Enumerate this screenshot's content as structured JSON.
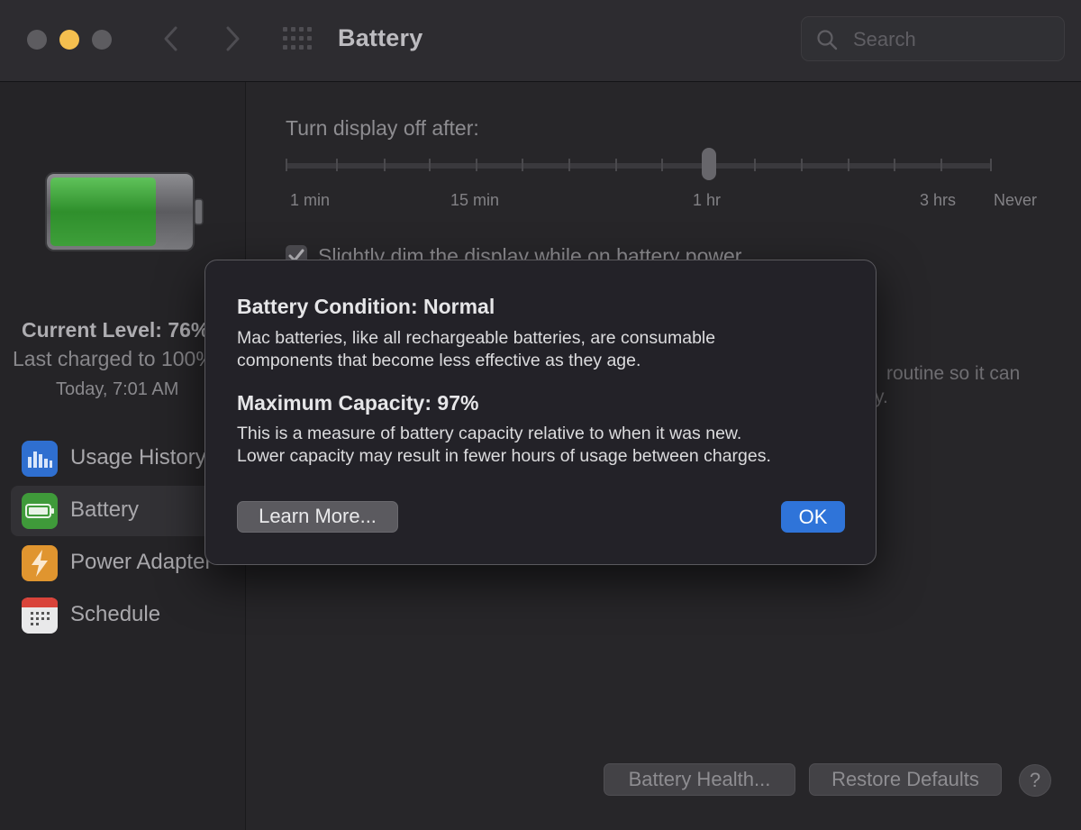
{
  "window": {
    "title": "Battery",
    "search": {
      "placeholder": "Search"
    }
  },
  "sidebar": {
    "current_level": "Current Level: 76%",
    "last_charged": "Last charged to 100%",
    "charged_time": "Today, 7:01 AM",
    "battery_fill_percent": 76,
    "items": [
      {
        "label": "Usage History",
        "icon": "bar-chart-icon",
        "color": "#2f6fd0",
        "selected": false
      },
      {
        "label": "Battery",
        "icon": "battery-icon",
        "color": "#3f9a3a",
        "selected": true
      },
      {
        "label": "Power Adapter",
        "icon": "lightning-icon",
        "color": "#e0952f",
        "selected": false
      },
      {
        "label": "Schedule",
        "icon": "calendar-icon",
        "color": "#e9e9ea",
        "selected": false
      }
    ]
  },
  "main": {
    "slider_title": "Turn display off after:",
    "slider_value": "1 hr",
    "tick_labels": [
      "1 min",
      "15 min",
      "1 hr",
      "3 hrs",
      "Never"
    ],
    "dim_checkbox": {
      "label": "Slightly dim the display while on battery power",
      "checked": true
    },
    "background_text_1": "routine so it can",
    "background_text_2": "y.",
    "buttons": {
      "battery_health": "Battery Health...",
      "restore_defaults": "Restore Defaults",
      "help": "?"
    }
  },
  "dialog": {
    "title1": "Battery Condition: Normal",
    "body1_line1": "Mac batteries, like all rechargeable batteries, are consumable",
    "body1_line2": "components that become less effective as they age.",
    "title2": "Maximum Capacity: 97%",
    "body2_line1": "This is a measure of battery capacity relative to when it was new.",
    "body2_line2": "Lower capacity may result in fewer hours of usage between charges.",
    "learn_more": "Learn More...",
    "ok": "OK"
  },
  "colors": {
    "accent": "#2f74d9",
    "battery_green": "#3aa53a",
    "traffic_yellow": "#f4bf4f"
  }
}
